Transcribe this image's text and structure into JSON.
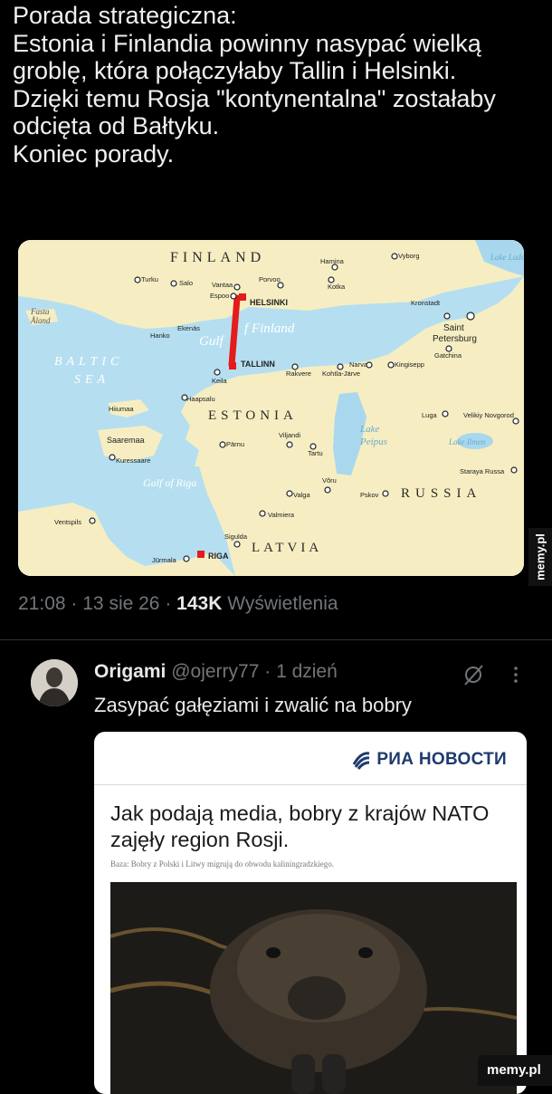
{
  "post": {
    "text": "Porada strategiczna:\nEstonia i Finlandia powinny nasypać wielką groblę, która połączyłaby Tallin i Helsinki. Dzięki temu Rosja \"kontynentalna\" zostałaby odcięta od Bałtyku.\nKoniec porady.",
    "time": "21:08",
    "date": "13 sie 26",
    "views_count": "143K",
    "views_label": "Wyświetlenia",
    "dot": "·"
  },
  "map": {
    "finland": "FINLAND",
    "baltic_sea_1": "BALTIC",
    "baltic_sea_2": "SEA",
    "gulf_of_finland_1": "Gulf",
    "gulf_of_finland_2": "f Finland",
    "estonia": "ESTONIA",
    "latvia": "LATVIA",
    "russia": "RUSSIA",
    "gulf_of_riga": "Gulf of Riga",
    "lake_peipus": "Lake Peipus",
    "lake_ladoga": "Lake Ladoga",
    "lake_ilmen": "Lake Ilmen",
    "saaremaa": "Saaremaa",
    "hiiumaa": "Hiiumaa",
    "aland": "Åland",
    "fasta": "Fasta",
    "cities": {
      "helsinki": "HELSINKI",
      "tallinn": "TALLINN",
      "riga": "RIGA",
      "turku": "Turku",
      "salo": "Salo",
      "vantaa": "Vantaa",
      "espoo": "Espoo",
      "porvoo": "Porvoo",
      "hamina": "Hamina",
      "kotka": "Kotka",
      "vyborg": "Vyborg",
      "kronstadt": "Kronstadt",
      "saint_petersburg": "Saint Petersburg",
      "gatchina": "Gatchina",
      "hanko": "Hanko",
      "ekenas": "Ekenäs",
      "keila": "Keila",
      "rakvere": "Rakvere",
      "kohtla": "Kohtla-Järve",
      "narva": "Narva",
      "kingisepp": "Kingisepp",
      "haapsalu": "Haapsalu",
      "viljandi": "Viljandi",
      "parnu": "Pärnu",
      "tartu": "Tartu",
      "voru": "Võru",
      "valga": "Valga",
      "valmiera": "Valmiera",
      "pskov": "Pskov",
      "luga": "Luga",
      "velikiy": "Velikiy Novgorod",
      "staraya": "Staraya Russa",
      "kuressaare": "Kuressaare",
      "ventspils": "Ventspils",
      "sigulda": "Sigulda",
      "jurmala": "Jūrmala"
    }
  },
  "reply": {
    "name": "Origami",
    "handle": "@ojerry77",
    "time": "1 dzień",
    "dot": "·",
    "text": "Zasypać gałęziami i zwalić na bobry"
  },
  "ria": {
    "logo": "РИА НОВОСТИ",
    "headline": "Jak podają media, bobry z krajów NATO zajęły region Rosji.",
    "subtitle": "Baza: Bobry z Polski i Litwy migrują do obwodu kaliningradzkiego."
  },
  "watermarks": {
    "side": "memy.pl",
    "bottom": "memy.pl"
  },
  "colors": {
    "sea": "#b5dff0",
    "land": "#f6eec2",
    "causeway": "#e41c1c",
    "ria_blue": "#1f3a6e"
  }
}
